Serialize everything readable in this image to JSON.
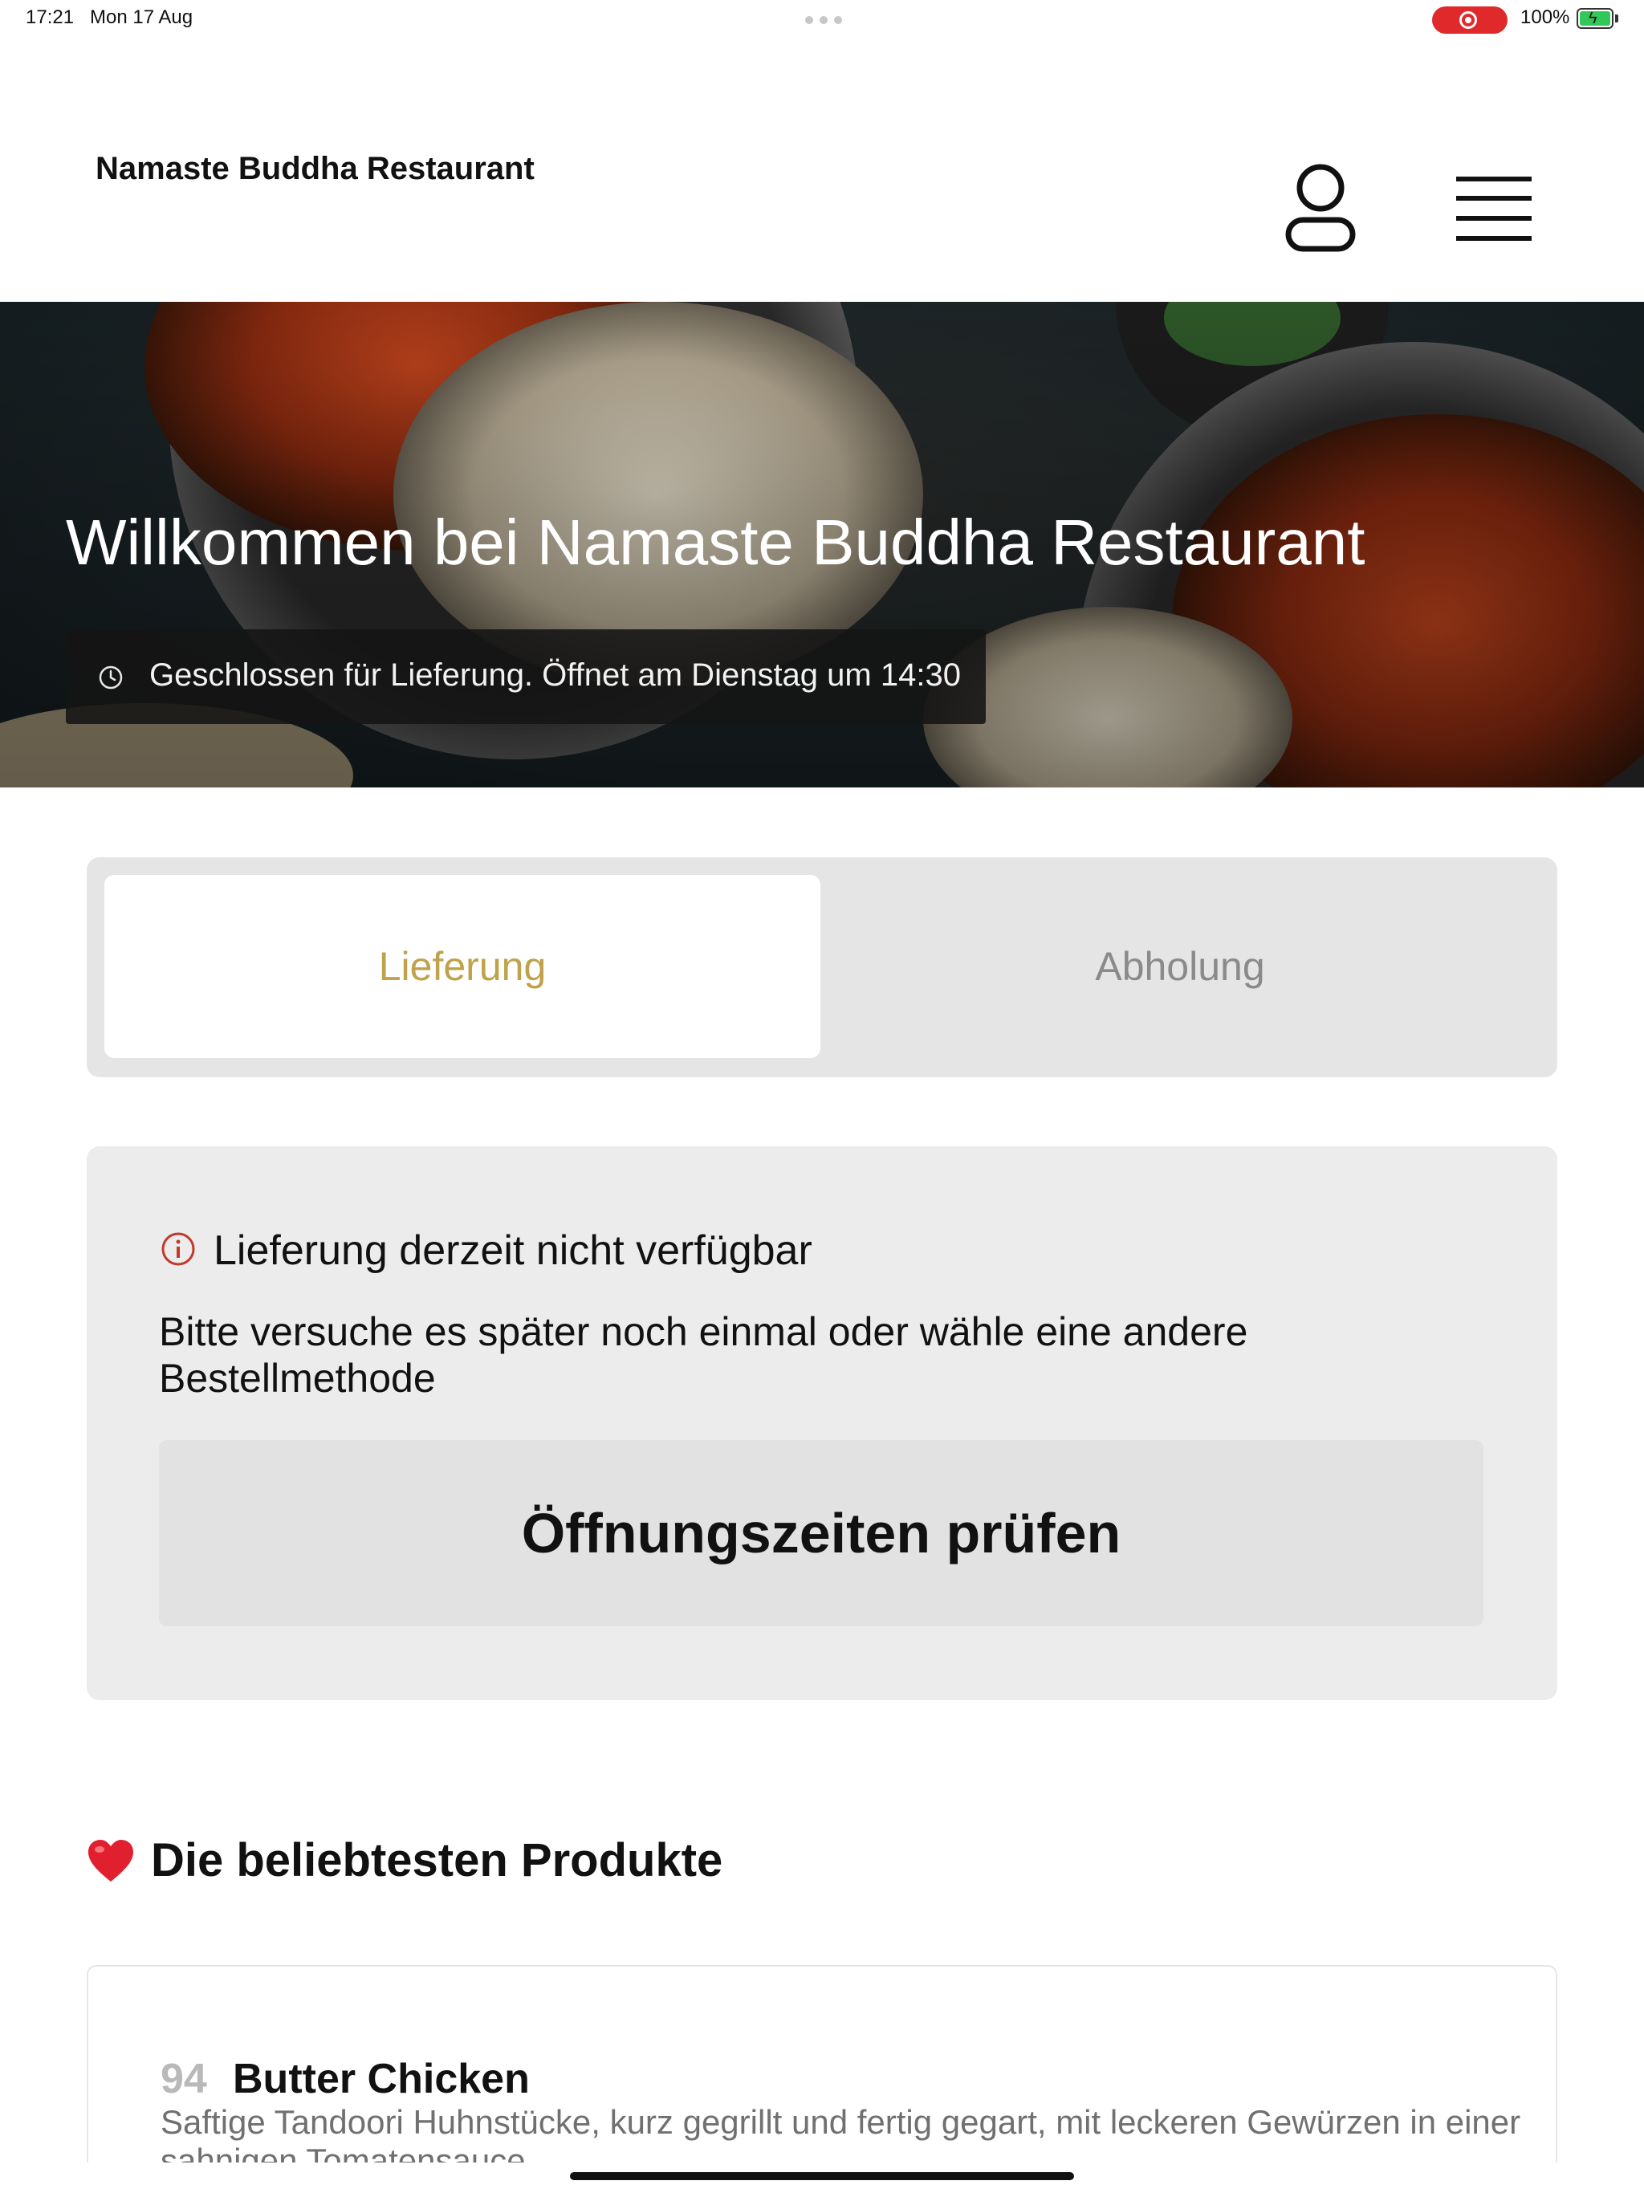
{
  "status_bar": {
    "time": "17:21",
    "date": "Mon 17 Aug",
    "battery": "100%"
  },
  "header": {
    "title": "Namaste Buddha Restaurant"
  },
  "hero": {
    "title": "Willkommen bei Namaste Buddha Restaurant",
    "status_text": "Geschlossen für Lieferung. Öffnet am Dienstag um 14:30"
  },
  "order_toggle": {
    "options": [
      {
        "label": "Lieferung",
        "selected": true
      },
      {
        "label": "Abholung",
        "selected": false
      }
    ]
  },
  "notice": {
    "title": "Lieferung derzeit nicht verfügbar",
    "text": "Bitte versuche es später noch einmal oder wähle eine andere Bestellmethode",
    "button_label": "Öffnungszeiten prüfen"
  },
  "popular": {
    "title": "Die beliebtesten Produkte",
    "products": [
      {
        "number": "94",
        "name": "Butter Chicken",
        "description": "Saftige Tandoori Huhnstücke, kurz gegrillt und fertig gegart, mit leckeren Gewürzen in einer sahnigen Tomatensauce"
      }
    ]
  },
  "colors": {
    "accent": "#bfa24a",
    "notice_icon": "#c0392b",
    "recording": "#e0292b",
    "battery": "#32c759"
  }
}
